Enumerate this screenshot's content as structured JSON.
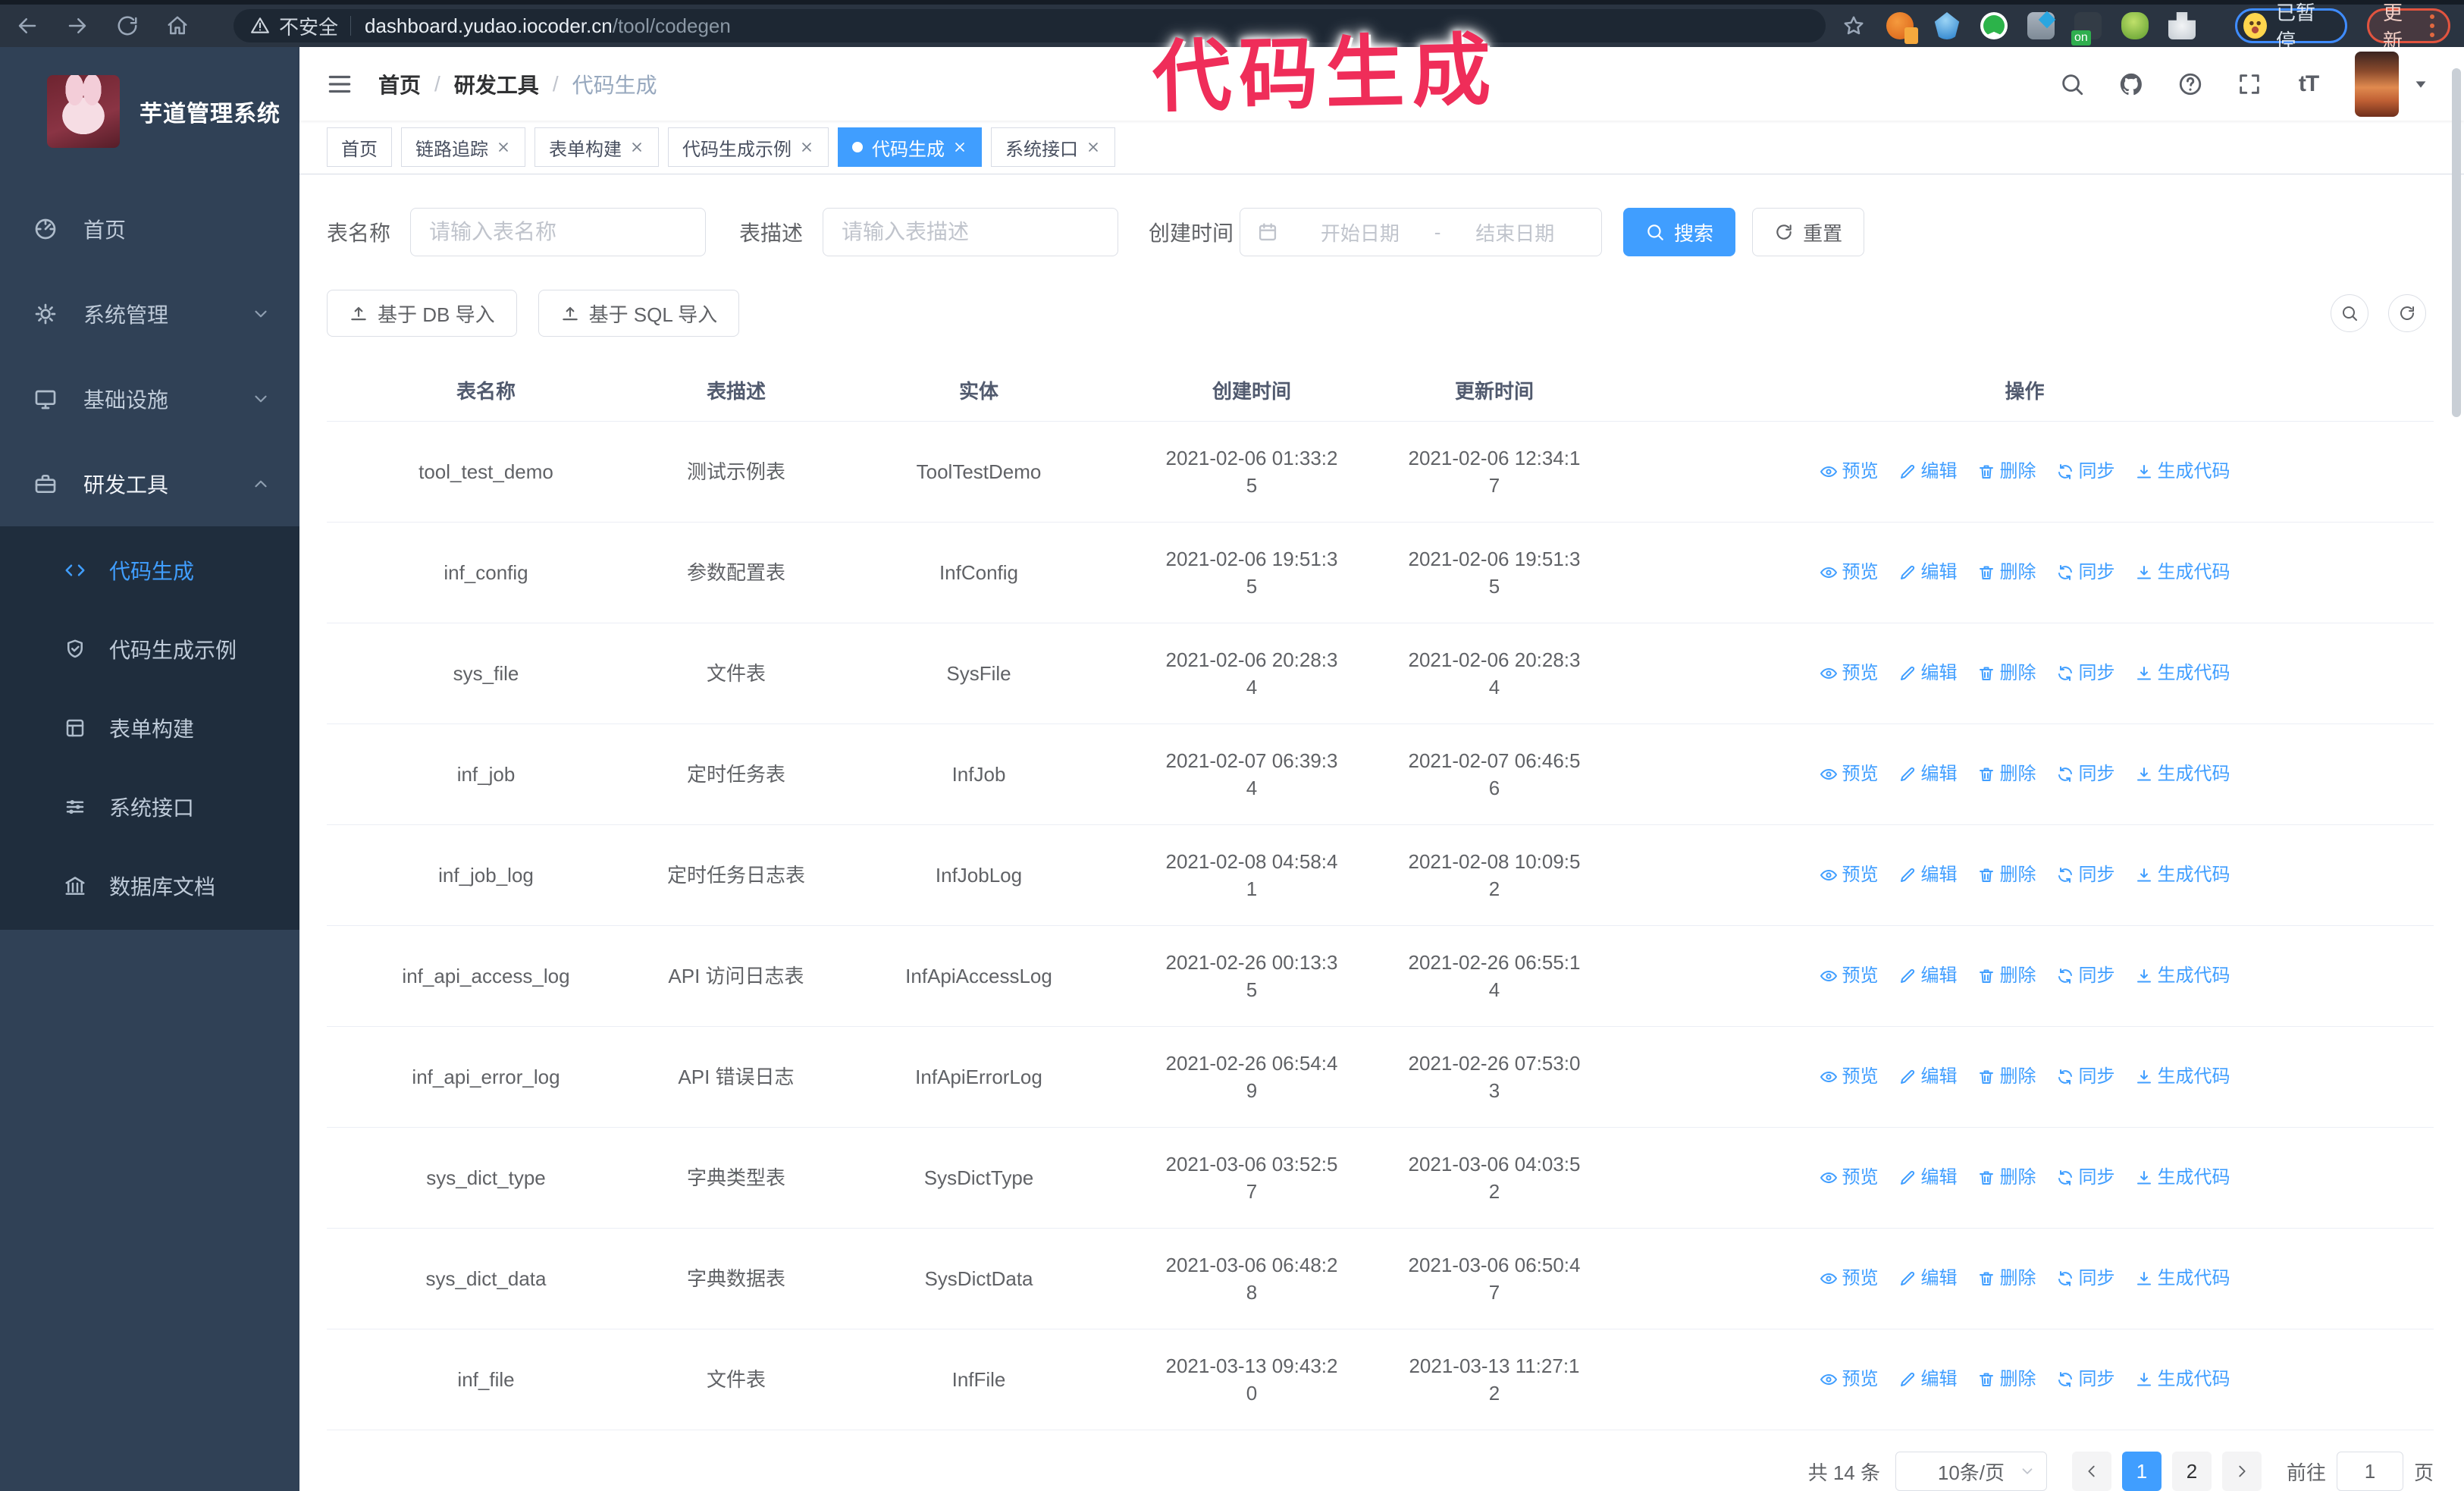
{
  "colors": {
    "accent": "#409eff",
    "annotation_pink": "#ef2d59",
    "sidebar_bg": "#304156",
    "submenu_bg": "#1f2d3d"
  },
  "annotation": {
    "text": "代码生成"
  },
  "browser": {
    "nav_icons": [
      "back-icon",
      "forward-icon",
      "reload-icon",
      "home-icon"
    ],
    "security_label": "不安全",
    "url_host": "dashboard.yudao.iocoder.cn",
    "url_path": "/tool/codegen",
    "extensions": [
      "ext-orange-icon",
      "ext-blue-drop-icon",
      "ext-green-check-icon",
      "ext-grid-blue-icon",
      "ext-dark-on-icon",
      "ext-green-blob-icon",
      "ext-puzzle-icon"
    ],
    "paused_badge": "已暂停",
    "update_badge": "更新"
  },
  "sidebar": {
    "title": "芋道管理系统",
    "items": [
      {
        "label": "首页",
        "icon": "dashboard-icon"
      },
      {
        "label": "系统管理",
        "icon": "gear-icon",
        "chevron": "down"
      },
      {
        "label": "基础设施",
        "icon": "monitor-icon",
        "chevron": "down"
      },
      {
        "label": "研发工具",
        "icon": "briefcase-icon",
        "chevron": "up",
        "active": true
      }
    ],
    "submenu": [
      {
        "label": "代码生成",
        "icon": "code-icon",
        "active": true
      },
      {
        "label": "代码生成示例",
        "icon": "shield-check-icon"
      },
      {
        "label": "表单构建",
        "icon": "form-icon"
      },
      {
        "label": "系统接口",
        "icon": "sliders-icon"
      },
      {
        "label": "数据库文档",
        "icon": "database-icon"
      }
    ]
  },
  "navbar": {
    "breadcrumb": [
      "首页",
      "研发工具",
      "代码生成"
    ],
    "right_icons": [
      "search-icon",
      "github-icon",
      "help-icon",
      "fullscreen-icon",
      "fontsize-icon"
    ],
    "fontsize_glyph": "tT"
  },
  "tabs": [
    {
      "label": "首页",
      "closable": false,
      "active": false
    },
    {
      "label": "链路追踪",
      "closable": true,
      "active": false
    },
    {
      "label": "表单构建",
      "closable": true,
      "active": false
    },
    {
      "label": "代码生成示例",
      "closable": true,
      "active": false
    },
    {
      "label": "代码生成",
      "closable": true,
      "active": true
    },
    {
      "label": "系统接口",
      "closable": true,
      "active": false
    }
  ],
  "filters": {
    "name_label": "表名称",
    "name_placeholder": "请输入表名称",
    "desc_label": "表描述",
    "desc_placeholder": "请输入表描述",
    "time_label": "创建时间",
    "start_placeholder": "开始日期",
    "range_separator": "-",
    "end_placeholder": "结束日期",
    "search_label": "搜索",
    "reset_label": "重置"
  },
  "toolbar": {
    "db_import_label": "基于 DB 导入",
    "sql_import_label": "基于 SQL 导入"
  },
  "table": {
    "columns": [
      "表名称",
      "表描述",
      "实体",
      "创建时间",
      "更新时间",
      "操作"
    ],
    "actions": [
      {
        "label": "预览",
        "icon": "eye-icon"
      },
      {
        "label": "编辑",
        "icon": "edit-icon"
      },
      {
        "label": "删除",
        "icon": "delete-icon"
      },
      {
        "label": "同步",
        "icon": "sync-icon"
      },
      {
        "label": "生成代码",
        "icon": "download-icon"
      }
    ],
    "rows": [
      {
        "name": "tool_test_demo",
        "desc": "测试示例表",
        "entity": "ToolTestDemo",
        "create_time": "2021-02-06 01:33:25",
        "update_time": "2021-02-06 12:34:17"
      },
      {
        "name": "inf_config",
        "desc": "参数配置表",
        "entity": "InfConfig",
        "create_time": "2021-02-06 19:51:35",
        "update_time": "2021-02-06 19:51:35"
      },
      {
        "name": "sys_file",
        "desc": "文件表",
        "entity": "SysFile",
        "create_time": "2021-02-06 20:28:34",
        "update_time": "2021-02-06 20:28:34"
      },
      {
        "name": "inf_job",
        "desc": "定时任务表",
        "entity": "InfJob",
        "create_time": "2021-02-07 06:39:34",
        "update_time": "2021-02-07 06:46:56"
      },
      {
        "name": "inf_job_log",
        "desc": "定时任务日志表",
        "entity": "InfJobLog",
        "create_time": "2021-02-08 04:58:41",
        "update_time": "2021-02-08 10:09:52"
      },
      {
        "name": "inf_api_access_log",
        "desc": "API 访问日志表",
        "entity": "InfApiAccessLog",
        "create_time": "2021-02-26 00:13:35",
        "update_time": "2021-02-26 06:55:14"
      },
      {
        "name": "inf_api_error_log",
        "desc": "API 错误日志",
        "entity": "InfApiErrorLog",
        "create_time": "2021-02-26 06:54:49",
        "update_time": "2021-02-26 07:53:03"
      },
      {
        "name": "sys_dict_type",
        "desc": "字典类型表",
        "entity": "SysDictType",
        "create_time": "2021-03-06 03:52:57",
        "update_time": "2021-03-06 04:03:52"
      },
      {
        "name": "sys_dict_data",
        "desc": "字典数据表",
        "entity": "SysDictData",
        "create_time": "2021-03-06 06:48:28",
        "update_time": "2021-03-06 06:50:47"
      },
      {
        "name": "inf_file",
        "desc": "文件表",
        "entity": "InfFile",
        "create_time": "2021-03-13 09:43:20",
        "update_time": "2021-03-13 11:27:12"
      }
    ]
  },
  "pagination": {
    "total": "共 14 条",
    "page_size": "10条/页",
    "pages": [
      "1",
      "2"
    ],
    "active_page": "1",
    "goto_label": "前往",
    "goto_value": "1",
    "page_unit": "页"
  }
}
